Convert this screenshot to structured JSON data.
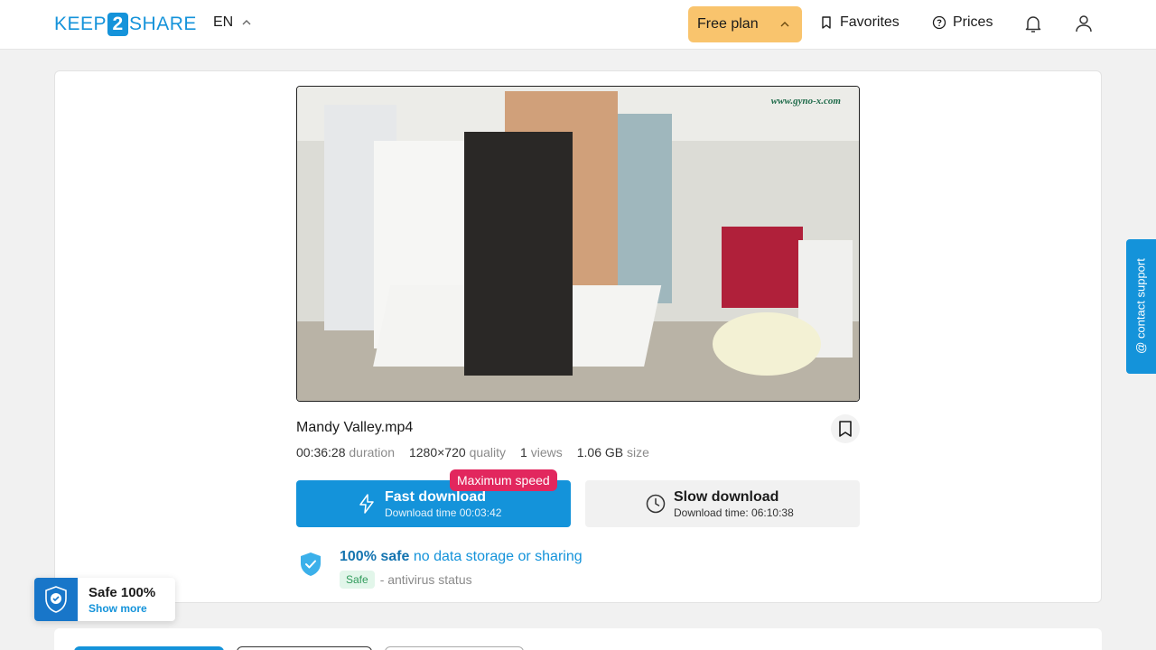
{
  "header": {
    "logo": {
      "left": "KEEP",
      "mid": "2",
      "right": "SHARE"
    },
    "language": "EN",
    "plan_label": "Free plan",
    "favorites_label": "Favorites",
    "prices_label": "Prices"
  },
  "file": {
    "name": "Mandy Valley.mp4",
    "watermark": "www.gyno-x.com",
    "duration_value": "00:36:28",
    "duration_label": "duration",
    "quality_value": "1280×720",
    "quality_label": "quality",
    "views_value": "1",
    "views_label": "views",
    "size_value": "1.06 GB",
    "size_label": "size"
  },
  "download": {
    "fast_label": "Fast download",
    "fast_time": "Download time 00:03:42",
    "badge": "Maximum speed",
    "slow_label": "Slow download",
    "slow_time": "Download time: 06:10:38"
  },
  "safety": {
    "strong": "100% safe",
    "rest": "no data storage or sharing",
    "pill": "Safe",
    "status": "- antivirus status"
  },
  "support_tab": "@ contact support",
  "safe_widget": {
    "title": "Safe 100%",
    "more": "Show more"
  },
  "colors": {
    "accent": "#1493da",
    "plan": "#f9c46d",
    "badge": "#e2275e"
  }
}
